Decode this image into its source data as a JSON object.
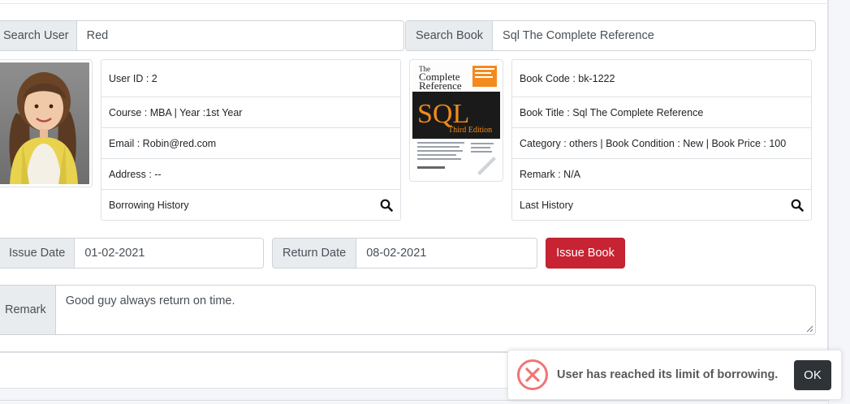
{
  "search_user": {
    "label": "Search User",
    "value": "Red"
  },
  "search_book": {
    "label": "Search Book",
    "value": "Sql The Complete Reference"
  },
  "user": {
    "user_id": "User ID : 2",
    "course_year": "Course : MBA | Year :1st Year",
    "email": "Email : Robin@red.com",
    "address": "Address : --",
    "history_label": "Borrowing History"
  },
  "book": {
    "code": "Book Code : bk-1222",
    "title": "Book Title : Sql The Complete Reference",
    "details": "Category : others | Book Condition : New | Book Price : 100",
    "remark": "Remark : N/A",
    "history_label": "Last History",
    "cover": {
      "the": "The",
      "complete": "Complete",
      "reference": "Reference",
      "sql": "SQL",
      "edition": "Third Edition"
    }
  },
  "issue_date": {
    "label": "Issue Date",
    "value": "01-02-2021"
  },
  "return_date": {
    "label": "Return Date",
    "value": "08-02-2021"
  },
  "issue_button": "Issue Book",
  "remark": {
    "label": "Remark",
    "value": "Good guy always return on time."
  },
  "toast": {
    "message": "User has reached its limit of borrowing.",
    "ok_label": "OK"
  },
  "colors": {
    "danger": "#c82333",
    "error_icon": "#f27474",
    "ok_button": "#2e3338"
  },
  "icons": {
    "search": "search-icon",
    "error": "error-x-icon"
  }
}
